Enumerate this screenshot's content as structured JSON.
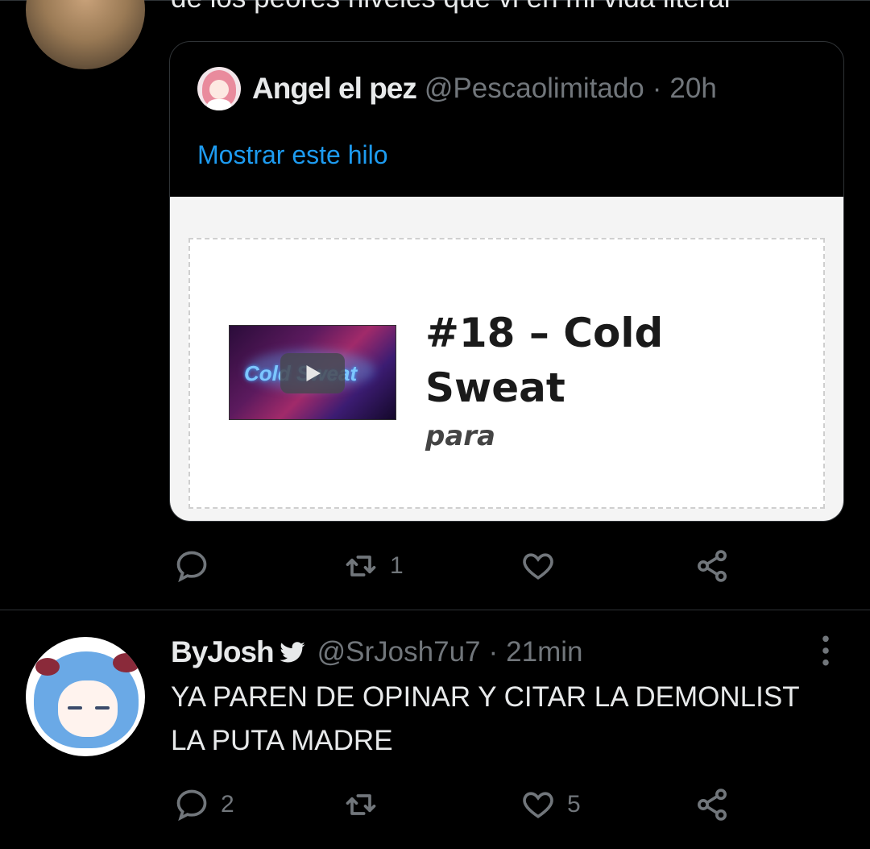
{
  "tweet1": {
    "text_partial": "de los peores niveles que vi en mi vida literal",
    "quote": {
      "author_name": "Angel el pez",
      "author_handle": "@Pescaolimitado",
      "separator": "·",
      "timestamp": "20h",
      "show_thread": "Mostrar este hilo",
      "video_thumb_text": "Cold Sweat",
      "level_title": "#18 – Cold Sweat",
      "level_subtitle": "para"
    },
    "actions": {
      "reply_count": "",
      "retweet_count": "1",
      "like_count": "",
      "share_count": ""
    }
  },
  "tweet2": {
    "author_name": "ByJosh",
    "author_handle": "@SrJosh7u7",
    "separator": "·",
    "timestamp": "21min",
    "text": "YA PAREN DE OPINAR Y CITAR LA DEMONLIST LA PUTA MADRE",
    "actions": {
      "reply_count": "2",
      "retweet_count": "",
      "like_count": "5",
      "share_count": ""
    }
  },
  "icons": {
    "reply": "reply-icon",
    "retweet": "retweet-icon",
    "like": "heart-icon",
    "share": "share-icon",
    "more": "more-vertical-icon",
    "bird": "bird-icon",
    "play": "play-icon"
  },
  "colors": {
    "background": "#000000",
    "text": "#e7e9ea",
    "secondary": "#71767b",
    "link": "#1d9bf0",
    "divider": "#2f3336"
  }
}
